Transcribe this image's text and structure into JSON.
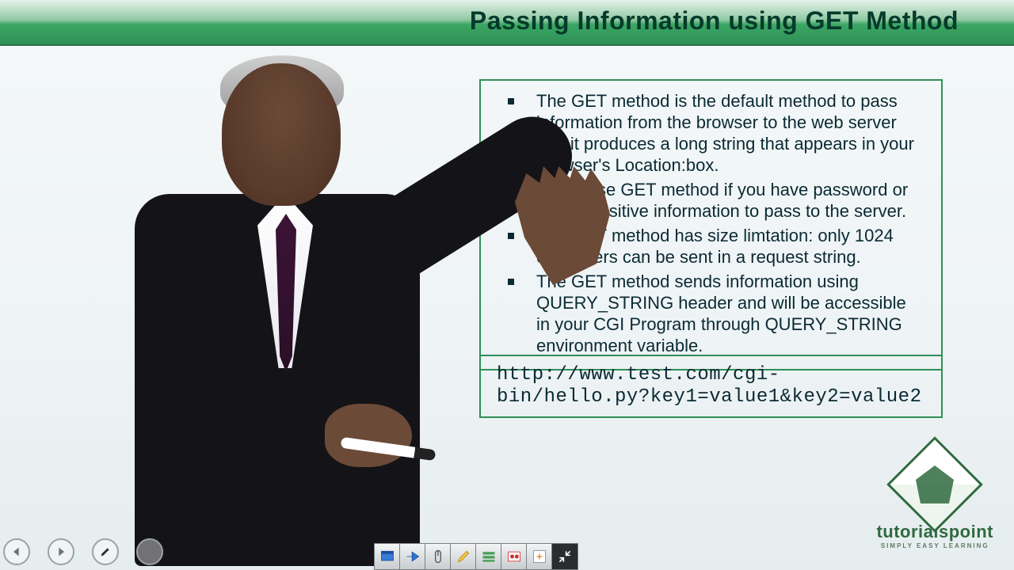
{
  "header": {
    "title": "Passing Information using GET Method"
  },
  "bullets": [
    "The GET method is the default method to pass information from the browser to the web server and it produces a long string that appears in your browser's Location:box.",
    "Never use GET method if you have password or other sensitive information to pass to the server.",
    "The GET method has size limtation: only 1024 characters can be sent in a request string.",
    "The GET method sends information using QUERY_STRING header and will be accessible in your CGI Program through QUERY_STRING environment variable."
  ],
  "code": {
    "line1": "http://www.test.com/cgi-",
    "line2": "bin/hello.py?key1=value1&key2=value2"
  },
  "logo": {
    "brand": "tutorialspoint",
    "tagline": "SIMPLY EASY LEARNING"
  }
}
